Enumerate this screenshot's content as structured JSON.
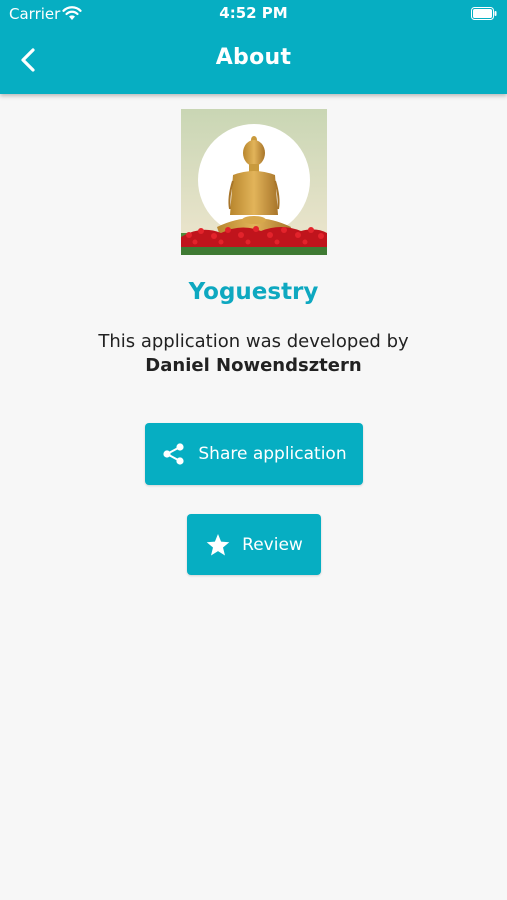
{
  "status_bar": {
    "carrier": "Carrier",
    "time": "4:52 PM"
  },
  "header": {
    "title": "About",
    "back_icon": "chevron-left-icon"
  },
  "app": {
    "name": "Yoguestry",
    "image": "meditating-buddha-image"
  },
  "developer": {
    "intro": "This application was developed by",
    "name": "Daniel Nowendsztern"
  },
  "actions": {
    "share_label": "Share application",
    "share_icon": "share-icon",
    "review_label": "Review",
    "review_icon": "star-icon"
  },
  "colors": {
    "accent": "#06aec2",
    "app_name": "#0ea8c0",
    "background": "#f7f7f7"
  }
}
